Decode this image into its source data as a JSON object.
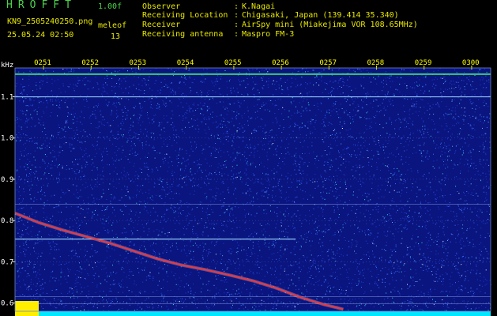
{
  "header": {
    "app_title": "HROFFT",
    "version": "1.00f",
    "filename": "KN9_2505240250.png",
    "tag": "meleof",
    "datetime": "25.05.24 02:50",
    "number": "13",
    "meta": [
      {
        "label": "Observer",
        "value": "K.Nagai"
      },
      {
        "label": "Receiving Location",
        "value": "Chigasaki, Japan (139.414 35.340)"
      },
      {
        "label": "Receiver",
        "value": "AirSpy mini (Miakejima VOR 108.65MHz)"
      },
      {
        "label": "Receiving antenna",
        "value": "Maspro FM-3"
      }
    ]
  },
  "colors": {
    "background": "#0a1580",
    "noise": [
      "#1e3fd0",
      "#3a70ff",
      "#5db0ff",
      "#3de0e0",
      "#ffffff"
    ],
    "header_green": "#4cd44c",
    "header_yellow": "#e8e800",
    "time_labels": "#ffff00",
    "axis_labels": "#ffffff",
    "grid": "#ffffff",
    "signal": "#e83a3a",
    "carrier": "#40e070",
    "baseline": "#00e8ff",
    "marker": "#ffee00"
  },
  "chart_data": {
    "type": "heatmap",
    "ylabel": "kHz",
    "x_ticks": [
      "0251",
      "0252",
      "0253",
      "0254",
      "0255",
      "0256",
      "0257",
      "0258",
      "0259",
      "0300"
    ],
    "y_ticks": [
      0.6,
      0.7,
      0.8,
      0.9,
      1.0,
      1.1
    ],
    "ylim": [
      0.58,
      1.17
    ],
    "xlim": [
      0,
      10
    ],
    "grid": true,
    "carriers": [
      {
        "freq": 1.155,
        "x_start": 0,
        "x_end": 10
      },
      {
        "freq": 1.1,
        "x_start": 0,
        "x_end": 10
      },
      {
        "freq": 0.755,
        "x_start": 0,
        "x_end": 5.9
      }
    ],
    "meteor_track": {
      "x": [
        0,
        0.5,
        1.0,
        1.5,
        2.0,
        2.5,
        3.0,
        3.5,
        4.0,
        4.5,
        5.0,
        5.5,
        6.0,
        6.5,
        6.9
      ],
      "freq": [
        0.818,
        0.795,
        0.777,
        0.761,
        0.745,
        0.726,
        0.707,
        0.692,
        0.681,
        0.668,
        0.654,
        0.636,
        0.614,
        0.596,
        0.585
      ]
    },
    "extra_lines": [
      0.84,
      0.615,
      0.598
    ]
  }
}
